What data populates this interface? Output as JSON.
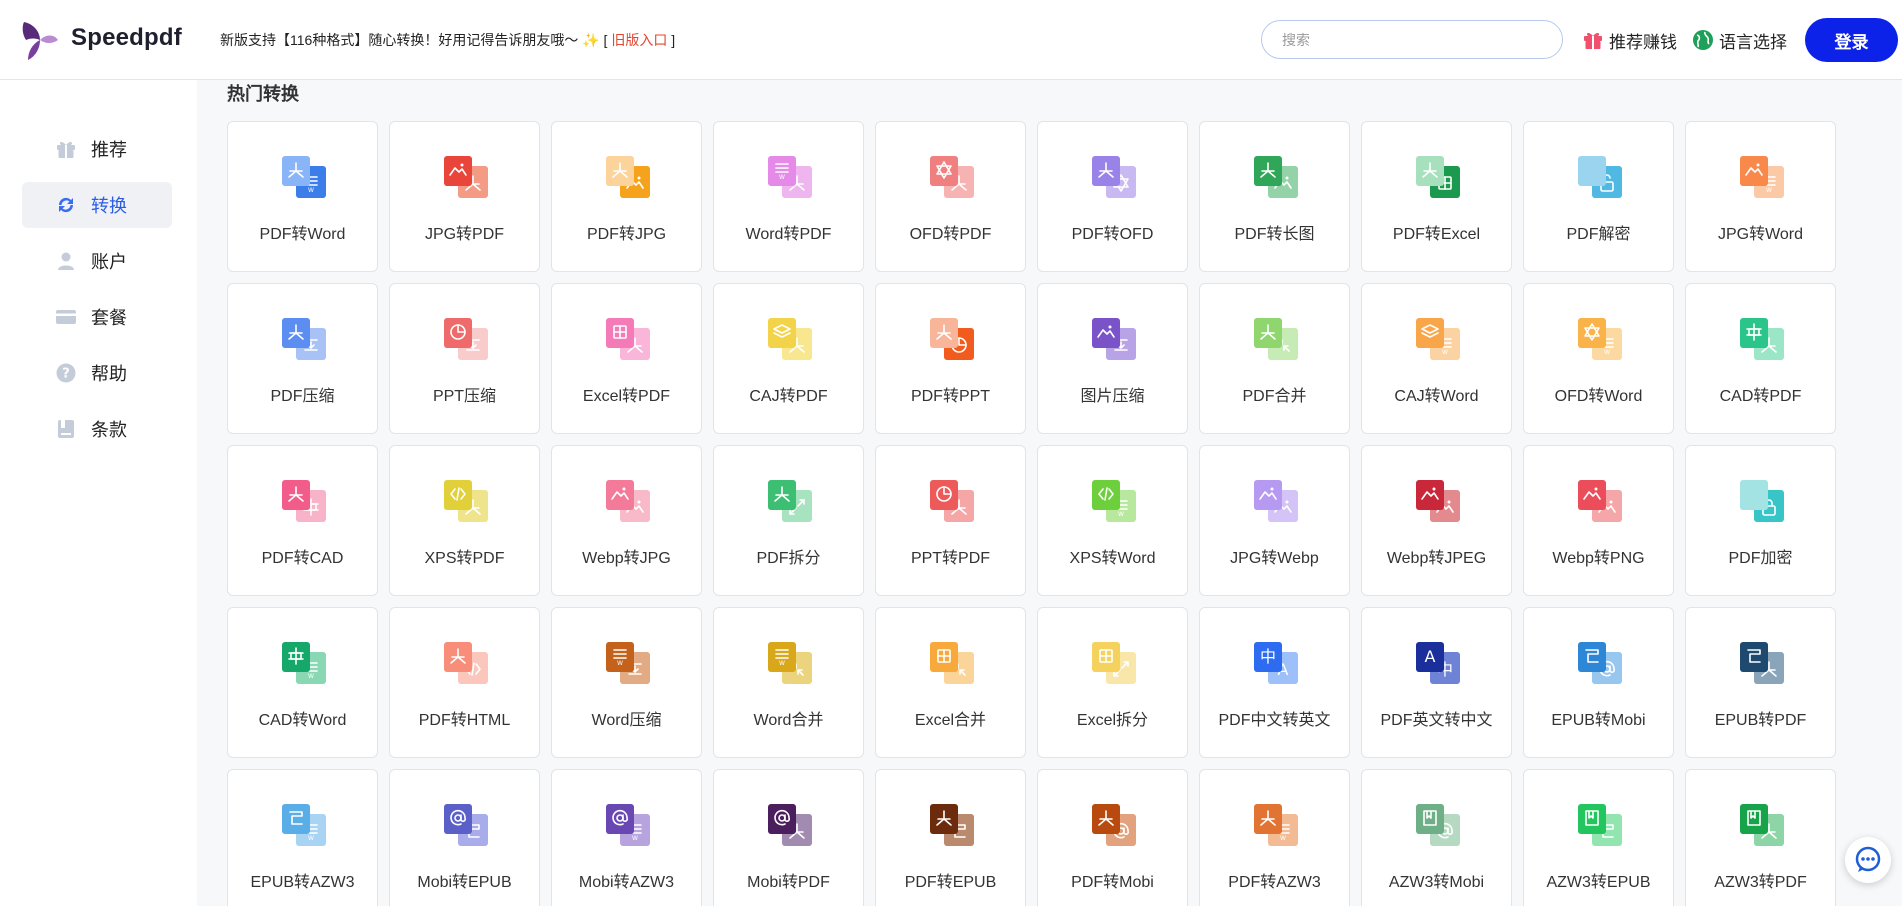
{
  "header": {
    "logo_text": "Speedpdf",
    "notice_text": "新版支持【116种格式】随心转换！好用记得告诉朋友哦～",
    "notice_bracket_open": "[",
    "notice_link": "旧版入口",
    "notice_bracket_close": "]",
    "search_placeholder": "搜索",
    "referral_label": "推荐赚钱",
    "language_label": "语言选择",
    "login_label": "登录"
  },
  "sidebar": {
    "items": [
      {
        "label": "推荐",
        "icon": "gift-icon",
        "active": false
      },
      {
        "label": "转换",
        "icon": "sync-icon",
        "active": true
      },
      {
        "label": "账户",
        "icon": "user-icon",
        "active": false
      },
      {
        "label": "套餐",
        "icon": "card-icon",
        "active": false
      },
      {
        "label": "帮助",
        "icon": "help-icon",
        "active": false
      },
      {
        "label": "条款",
        "icon": "document-icon",
        "active": false
      }
    ]
  },
  "main": {
    "section_title": "热门转换",
    "tools": [
      {
        "label": "PDF转Word",
        "icon": "pdf-to-word-icon",
        "c1": "#8ab4f8",
        "c2": "#3b7de9",
        "g1": "pdf",
        "g2": "doc"
      },
      {
        "label": "JPG转PDF",
        "icon": "jpg-to-pdf-icon",
        "c1": "#e9453a",
        "c2": "#f49b86",
        "g1": "img",
        "g2": "pdf"
      },
      {
        "label": "PDF转JPG",
        "icon": "pdf-to-jpg-icon",
        "c1": "#fcd39a",
        "c2": "#f5a31d",
        "g1": "pdf",
        "g2": "img"
      },
      {
        "label": "Word转PDF",
        "icon": "word-to-pdf-icon",
        "c1": "#e58ae8",
        "c2": "#efb5ef",
        "g1": "doc",
        "g2": "pdf"
      },
      {
        "label": "OFD转PDF",
        "icon": "ofd-to-pdf-icon",
        "c1": "#f08080",
        "c2": "#f7b2b2",
        "g1": "gear",
        "g2": "pdf"
      },
      {
        "label": "PDF转OFD",
        "icon": "pdf-to-ofd-icon",
        "c1": "#9a83e8",
        "c2": "#c9b9f3",
        "g1": "pdf",
        "g2": "gear"
      },
      {
        "label": "PDF转长图",
        "icon": "pdf-to-long-image-icon",
        "c1": "#2fa658",
        "c2": "#93d3a7",
        "g1": "pdf",
        "g2": "img"
      },
      {
        "label": "PDF转Excel",
        "icon": "pdf-to-excel-icon",
        "c1": "#a6e0bd",
        "c2": "#1b9a4f",
        "g1": "pdf",
        "g2": "grid"
      },
      {
        "label": "PDF解密",
        "icon": "pdf-decrypt-icon",
        "c1": "#9ad4ee",
        "c2": "#4fb8e3",
        "g1": "none",
        "g2": "unlock"
      },
      {
        "label": "JPG转Word",
        "icon": "jpg-to-word-icon",
        "c1": "#f8894a",
        "c2": "#fbc9a6",
        "g1": "img",
        "g2": "doc"
      },
      {
        "label": "PDF压缩",
        "icon": "pdf-compress-icon",
        "c1": "#5b8ef0",
        "c2": "#a8c2f5",
        "g1": "pdf",
        "g2": "zip"
      },
      {
        "label": "PPT压缩",
        "icon": "ppt-compress-icon",
        "c1": "#ef6a6a",
        "c2": "#f9cccc",
        "g1": "pie",
        "g2": "zip"
      },
      {
        "label": "Excel转PDF",
        "icon": "excel-to-pdf-icon",
        "c1": "#f57ab8",
        "c2": "#f9b6d8",
        "g1": "grid",
        "g2": "pdf"
      },
      {
        "label": "CAJ转PDF",
        "icon": "caj-to-pdf-icon",
        "c1": "#f3d34a",
        "c2": "#f8e78f",
        "g1": "layers",
        "g2": "pdf"
      },
      {
        "label": "PDF转PPT",
        "icon": "pdf-to-ppt-icon",
        "c1": "#f8b59a",
        "c2": "#f15b1d",
        "g1": "pdf",
        "g2": "pie"
      },
      {
        "label": "图片压缩",
        "icon": "image-compress-icon",
        "c1": "#7a53c9",
        "c2": "#b8a3e6",
        "g1": "img",
        "g2": "zip"
      },
      {
        "label": "PDF合并",
        "icon": "pdf-merge-icon",
        "c1": "#8fd66e",
        "c2": "#c7ebb4",
        "g1": "pdf",
        "g2": "merge"
      },
      {
        "label": "CAJ转Word",
        "icon": "caj-to-word-icon",
        "c1": "#f9a64b",
        "c2": "#fbd3a2",
        "g1": "layers",
        "g2": "doc"
      },
      {
        "label": "OFD转Word",
        "icon": "ofd-to-word-icon",
        "c1": "#f9b348",
        "c2": "#fcd9a0",
        "g1": "gear",
        "g2": "doc"
      },
      {
        "label": "CAD转PDF",
        "icon": "cad-to-pdf-icon",
        "c1": "#2bc48b",
        "c2": "#9be6c6",
        "g1": "cad",
        "g2": "pdf"
      },
      {
        "label": "PDF转CAD",
        "icon": "pdf-to-cad-icon",
        "c1": "#f25c8a",
        "c2": "#f9b3c9",
        "g1": "pdf",
        "g2": "cad"
      },
      {
        "label": "XPS转PDF",
        "icon": "xps-to-pdf-icon",
        "c1": "#e2d03a",
        "c2": "#efe48c",
        "g1": "code",
        "g2": "pdf"
      },
      {
        "label": "Webp转JPG",
        "icon": "webp-to-jpg-icon",
        "c1": "#f47a9a",
        "c2": "#f8b9c9",
        "g1": "img",
        "g2": "img"
      },
      {
        "label": "PDF拆分",
        "icon": "pdf-split-icon",
        "c1": "#3cbf73",
        "c2": "#a8e3c0",
        "g1": "pdf",
        "g2": "split"
      },
      {
        "label": "PPT转PDF",
        "icon": "ppt-to-pdf-icon",
        "c1": "#ec5a5a",
        "c2": "#f5a7a7",
        "g1": "pie",
        "g2": "pdf"
      },
      {
        "label": "XPS转Word",
        "icon": "xps-to-word-icon",
        "c1": "#6dcf3b",
        "c2": "#b8e89e",
        "g1": "code",
        "g2": "doc"
      },
      {
        "label": "JPG转Webp",
        "icon": "jpg-to-webp-icon",
        "c1": "#b69af2",
        "c2": "#d3c3f6",
        "g1": "img",
        "g2": "img"
      },
      {
        "label": "Webp转JPEG",
        "icon": "webp-to-jpeg-icon",
        "c1": "#c9283a",
        "c2": "#e38a8f",
        "g1": "img",
        "g2": "img"
      },
      {
        "label": "Webp转PNG",
        "icon": "webp-to-png-icon",
        "c1": "#ec4d5a",
        "c2": "#f5a6a8",
        "g1": "img",
        "g2": "img"
      },
      {
        "label": "PDF加密",
        "icon": "pdf-encrypt-icon",
        "c1": "#a4e3e4",
        "c2": "#38c5c8",
        "g1": "none",
        "g2": "lock"
      },
      {
        "label": "CAD转Word",
        "icon": "cad-to-word-icon",
        "c1": "#16a86b",
        "c2": "#8ad7b3",
        "g1": "cad",
        "g2": "doc"
      },
      {
        "label": "PDF转HTML",
        "icon": "pdf-to-html-icon",
        "c1": "#f88e7a",
        "c2": "#fbc6bb",
        "g1": "pdf",
        "g2": "code"
      },
      {
        "label": "Word压缩",
        "icon": "word-compress-icon",
        "c1": "#c4611b",
        "c2": "#e2ab84",
        "g1": "doc",
        "g2": "zip"
      },
      {
        "label": "Word合并",
        "icon": "word-merge-icon",
        "c1": "#d9a81a",
        "c2": "#ecd37e",
        "g1": "doc",
        "g2": "merge"
      },
      {
        "label": "Excel合并",
        "icon": "excel-merge-icon",
        "c1": "#f7a93c",
        "c2": "#fbd49a",
        "g1": "grid",
        "g2": "merge"
      },
      {
        "label": "Excel拆分",
        "icon": "excel-split-icon",
        "c1": "#f4d25d",
        "c2": "#f9e7a9",
        "g1": "grid",
        "g2": "split"
      },
      {
        "label": "PDF中文转英文",
        "icon": "pdf-chinese-to-english-icon",
        "c1": "#2d6cf0",
        "c2": "#9ec0fa",
        "g1": "zh",
        "g2": "en"
      },
      {
        "label": "PDF英文转中文",
        "icon": "pdf-english-to-chinese-icon",
        "c1": "#1b2f9c",
        "c2": "#6f83d6",
        "g1": "en",
        "g2": "zh"
      },
      {
        "label": "EPUB转Mobi",
        "icon": "epub-to-mobi-icon",
        "c1": "#2d86d6",
        "c2": "#97c6ef",
        "g1": "epub",
        "g2": "at"
      },
      {
        "label": "EPUB转PDF",
        "icon": "epub-to-pdf-icon",
        "c1": "#1d4a6e",
        "c2": "#8aa4ba",
        "g1": "epub",
        "g2": "pdf"
      },
      {
        "label": "EPUB转AZW3",
        "icon": "epub-to-azw3-icon",
        "c1": "#5aaee8",
        "c2": "#a9d3f3",
        "g1": "epub",
        "g2": "doc"
      },
      {
        "label": "Mobi转EPUB",
        "icon": "mobi-to-epub-icon",
        "c1": "#5b60c9",
        "c2": "#a9acea",
        "g1": "at",
        "g2": "epub"
      },
      {
        "label": "Mobi转AZW3",
        "icon": "mobi-to-azw3-icon",
        "c1": "#6a48b4",
        "c2": "#b7a4df",
        "g1": "at",
        "g2": "doc"
      },
      {
        "label": "Mobi转PDF",
        "icon": "mobi-to-pdf-icon",
        "c1": "#4b1e5e",
        "c2": "#a28bb0",
        "g1": "at",
        "g2": "pdf"
      },
      {
        "label": "PDF转EPUB",
        "icon": "pdf-to-epub-icon",
        "c1": "#6b2b0c",
        "c2": "#b98a6e",
        "g1": "pdf",
        "g2": "epub"
      },
      {
        "label": "PDF转Mobi",
        "icon": "pdf-to-mobi-icon",
        "c1": "#b84a0f",
        "c2": "#e2a27d",
        "g1": "pdf",
        "g2": "at"
      },
      {
        "label": "PDF转AZW3",
        "icon": "pdf-to-azw3-icon",
        "c1": "#e27433",
        "c2": "#f3bb93",
        "g1": "pdf",
        "g2": "doc"
      },
      {
        "label": "AZW3转Mobi",
        "icon": "azw3-to-mobi-icon",
        "c1": "#6faf88",
        "c2": "#b6d9c2",
        "g1": "book",
        "g2": "at"
      },
      {
        "label": "AZW3转EPUB",
        "icon": "azw3-to-epub-icon",
        "c1": "#22c55e",
        "c2": "#93e5b0",
        "g1": "book",
        "g2": "epub"
      },
      {
        "label": "AZW3转PDF",
        "icon": "azw3-to-pdf-icon",
        "c1": "#16a34a",
        "c2": "#8dd5a7",
        "g1": "book",
        "g2": "pdf"
      }
    ]
  },
  "colors": {
    "brand_blue": "#0c22e8",
    "active_nav_text": "#2b5ce6",
    "notice_link": "#e5452f"
  }
}
